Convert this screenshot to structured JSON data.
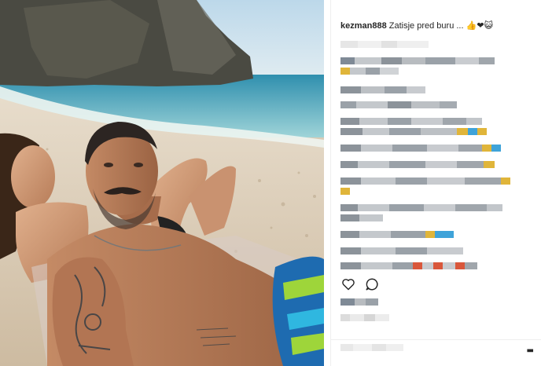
{
  "post": {
    "username": "kezman888",
    "caption_text": "Zatisje pred buru ...",
    "caption_emojis": "👍❤😺"
  },
  "icons": {
    "like": "heart-outline-icon",
    "comment": "comment-bubble-icon",
    "more": "more-options-icon"
  },
  "colors": {
    "text": "#262626",
    "divider": "#efefef",
    "sea": "#4fa7bd",
    "sky": "#cfe3ee"
  }
}
